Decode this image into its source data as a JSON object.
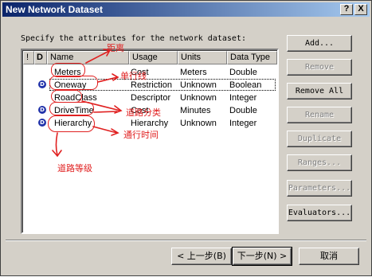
{
  "window": {
    "title": "New Network Dataset",
    "help_btn": "?",
    "close_btn": "X"
  },
  "instruction": "Specify the attributes for the network dataset:",
  "table": {
    "headers": [
      "!",
      "D",
      "Name",
      "Usage",
      "Units",
      "Data Type"
    ],
    "rows": [
      {
        "name": "Meters",
        "usage": "Cost",
        "units": "Meters",
        "datatype": "Double"
      },
      {
        "name": "Oneway",
        "usage": "Restriction",
        "units": "Unknown",
        "datatype": "Boolean"
      },
      {
        "name": "RoadClass",
        "usage": "Descriptor",
        "units": "Unknown",
        "datatype": "Integer"
      },
      {
        "name": "DriveTime",
        "usage": "Cost",
        "units": "Minutes",
        "datatype": "Double"
      },
      {
        "name": "Hierarchy",
        "usage": "Hierarchy",
        "units": "Unknown",
        "datatype": "Integer"
      }
    ]
  },
  "buttons": {
    "add": "Add...",
    "remove": "Remove",
    "remove_all": "Remove All",
    "rename": "Rename",
    "duplicate": "Duplicate",
    "ranges": "Ranges...",
    "parameters": "Parameters...",
    "evaluators": "Evaluators..."
  },
  "footer": {
    "back": "< 上一步(B)",
    "next": "下一步(N) >",
    "cancel": "取消"
  },
  "annotations": {
    "distance": "距离",
    "oneway": "单行线",
    "road_class": "道路分类",
    "drive_time": "通行时间",
    "hierarchy": "道路等级"
  }
}
